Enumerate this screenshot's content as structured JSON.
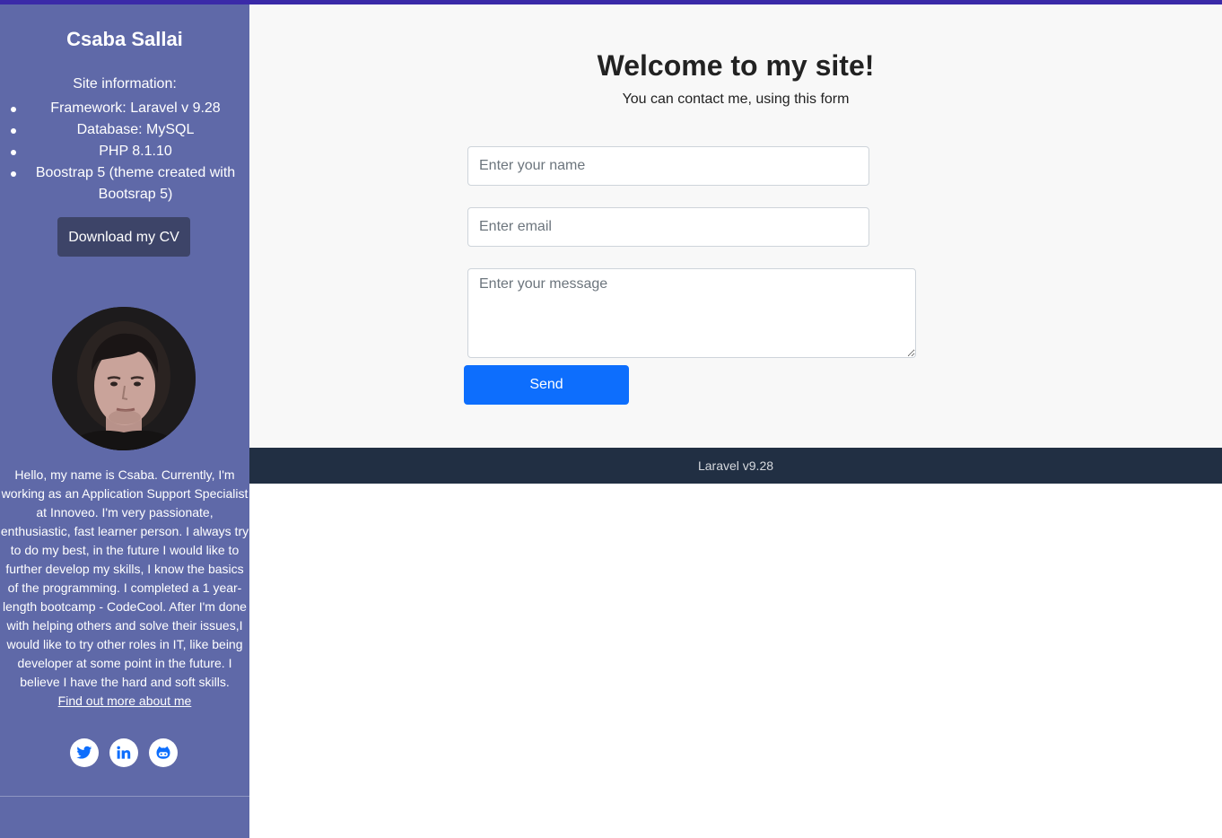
{
  "sidebar": {
    "name": "Csaba Sallai",
    "info_heading": "Site information:",
    "info_items": [
      "Framework: Laravel v 9.28",
      "Database: MySQL",
      "PHP 8.1.10",
      "Boostrap 5 (theme created with Bootsrap 5)"
    ],
    "cv_button": "Download my CV",
    "bio": "Hello, my name is Csaba. Currently, I'm working as an Application Support Specialist at Innoveo. I'm very passionate, enthusiastic, fast learner person. I always try to do my best, in the future I would like to further develop my skills, I know the basics of the programming. I completed a 1 year-length bootcamp - CodeCool. After I'm done with helping others and solve their issues,I would like to try other roles in IT, like being developer at some point in the future. I believe I have the hard and soft skills.",
    "bio_link": "Find out more about me",
    "social_icons": [
      "twitter-icon",
      "linkedin-icon",
      "github-icon"
    ]
  },
  "main": {
    "title": "Welcome to my site!",
    "subtitle": "You can contact me, using this form",
    "form": {
      "name_placeholder": "Enter your name",
      "email_placeholder": "Enter email",
      "message_placeholder": "Enter your message",
      "send_label": "Send"
    }
  },
  "footer": {
    "text": "Laravel v9.28"
  },
  "colors": {
    "top_bar": "#3a2aa8",
    "sidebar_bg": "#5f69a8",
    "cv_button_bg": "#3d4468",
    "send_button_bg": "#0d6efd",
    "footer_bg": "#212f43",
    "main_bg": "#f8f8f8"
  }
}
